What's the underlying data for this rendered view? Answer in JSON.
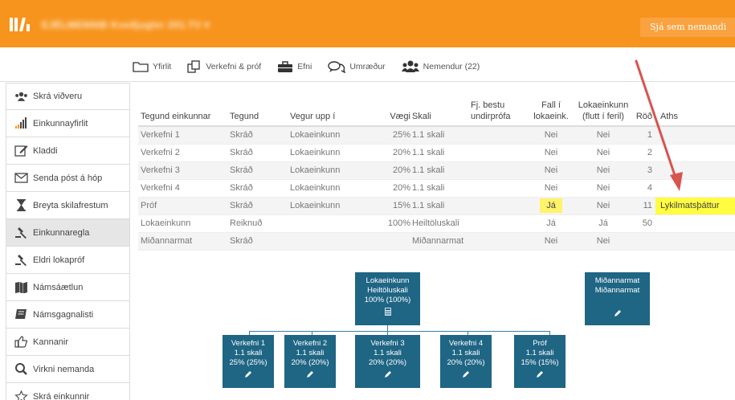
{
  "header": {
    "course_title": "EJÉLMENNIÐ Kveðjugler 201.TV ▾",
    "view_as_student": "Sjá sem nemandi"
  },
  "tabs": [
    {
      "label": "Yfirlit",
      "icon": "folder-icon"
    },
    {
      "label": "Verkefni & próf",
      "icon": "copy-icon"
    },
    {
      "label": "Efni",
      "icon": "briefcase-icon"
    },
    {
      "label": "Umræður",
      "icon": "comments-icon"
    },
    {
      "label": "Nemendur (22)",
      "icon": "users-icon"
    }
  ],
  "sidebar": {
    "items": [
      {
        "label": "Skrá viðveru",
        "icon": "users-icon"
      },
      {
        "label": "Einkunnayfirlit",
        "icon": "bar-chart-icon"
      },
      {
        "label": "Kladdi",
        "icon": "edit-icon"
      },
      {
        "label": "Senda póst á hóp",
        "icon": "envelope-icon"
      },
      {
        "label": "Breyta skilafrestum",
        "icon": "hourglass-icon"
      },
      {
        "label": "Einkunnaregla",
        "icon": "gavel-icon"
      },
      {
        "label": "Eldri lokapróf",
        "icon": "gavel-icon"
      },
      {
        "label": "Námsáætlun",
        "icon": "map-icon"
      },
      {
        "label": "Námsgagnalisti",
        "icon": "book-icon"
      },
      {
        "label": "Kannanir",
        "icon": "thumbs-up-icon"
      },
      {
        "label": "Virkni nemanda",
        "icon": "search-icon"
      },
      {
        "label": "Skrá einkunnir",
        "icon": "star-icon"
      }
    ],
    "active_index": 5
  },
  "table": {
    "headers": [
      "Tegund einkunnar",
      "Tegund",
      "Vegur upp í",
      "Vægi",
      "Skali",
      "Fj. bestu undirprófa",
      "Fall í lokaeink.",
      "Lokaeinkunn (flutt í feril)",
      "Röð",
      "Aths"
    ],
    "rows": [
      [
        "Verkefni 1",
        "Skráð",
        "Lokaeinkunn",
        "25%",
        "1.1 skali",
        "",
        "Nei",
        "Nei",
        "1",
        ""
      ],
      [
        "Verkefni 2",
        "Skráð",
        "Lokaeinkunn",
        "20%",
        "1.1 skali",
        "",
        "Nei",
        "Nei",
        "2",
        ""
      ],
      [
        "Verkefni 3",
        "Skráð",
        "Lokaeinkunn",
        "20%",
        "1.1 skali",
        "",
        "Nei",
        "Nei",
        "3",
        ""
      ],
      [
        "Verkefni 4",
        "Skráð",
        "Lokaeinkunn",
        "20%",
        "1.1 skali",
        "",
        "Nei",
        "Nei",
        "4",
        ""
      ],
      [
        "Próf",
        "Skráð",
        "Lokaeinkunn",
        "15%",
        "1.1 skali",
        "",
        "Já",
        "Nei",
        "11",
        "Lykilmatsþáttur"
      ],
      [
        "Lokaeinkunn",
        "Reiknuð",
        "",
        "100%",
        "Heiltöluskali",
        "",
        "Já",
        "Já",
        "50",
        ""
      ],
      [
        "Miðannarmat",
        "Skráð",
        "",
        "",
        "Miðannarmat",
        "",
        "Nei",
        "Nei",
        "",
        ""
      ]
    ]
  },
  "tree": {
    "root": {
      "line1": "Lokaeinkunn",
      "line2": "Heiltöluskali",
      "line3": "100% (100%)"
    },
    "side": {
      "line1": "Miðannarmat",
      "line2": "Miðannarmat"
    },
    "children": [
      {
        "line1": "Verkefni 1",
        "line2": "1.1 skali",
        "line3": "25% (25%)"
      },
      {
        "line1": "Verkefni 2",
        "line2": "1.1 skali",
        "line3": "20% (20%)"
      },
      {
        "line1": "Verkefni 3",
        "line2": "1.1 skali",
        "line3": "20% (20%)"
      },
      {
        "line1": "Verkefni 4",
        "line2": "1.1 skali",
        "line3": "20% (20%)"
      },
      {
        "line1": "Próf",
        "line2": "1.1 skali",
        "line3": "15% (15%)"
      }
    ]
  },
  "colors": {
    "topbar": "#f7941d",
    "node": "#1f6584",
    "highlight": "#fffc41",
    "arrow": "#d9534f"
  }
}
